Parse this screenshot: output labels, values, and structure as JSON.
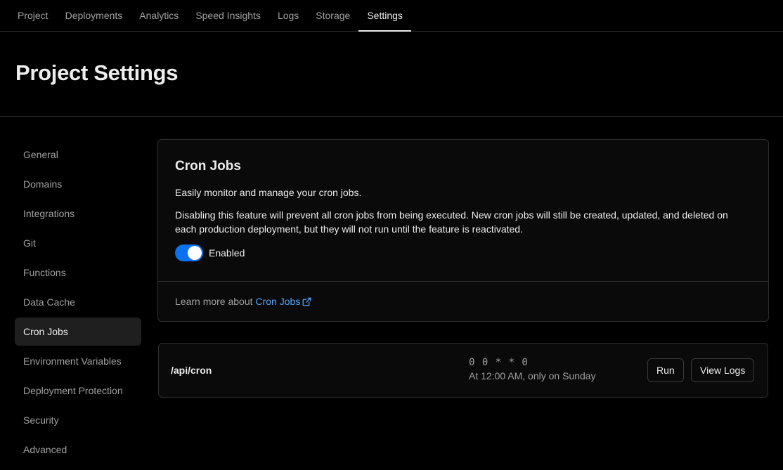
{
  "topnav": {
    "tabs": [
      {
        "label": "Project"
      },
      {
        "label": "Deployments"
      },
      {
        "label": "Analytics"
      },
      {
        "label": "Speed Insights"
      },
      {
        "label": "Logs"
      },
      {
        "label": "Storage"
      },
      {
        "label": "Settings",
        "active": true
      }
    ]
  },
  "header": {
    "title": "Project Settings"
  },
  "sidebar": {
    "items": [
      {
        "label": "General"
      },
      {
        "label": "Domains"
      },
      {
        "label": "Integrations"
      },
      {
        "label": "Git"
      },
      {
        "label": "Functions"
      },
      {
        "label": "Data Cache"
      },
      {
        "label": "Cron Jobs",
        "active": true
      },
      {
        "label": "Environment Variables"
      },
      {
        "label": "Deployment Protection"
      },
      {
        "label": "Security"
      },
      {
        "label": "Advanced"
      }
    ]
  },
  "cron_card": {
    "title": "Cron Jobs",
    "description": "Easily monitor and manage your cron jobs.",
    "note": "Disabling this feature will prevent all cron jobs from being executed. New cron jobs will still be created, updated, and deleted on each production deployment, but they will not run until the feature is reactivated.",
    "toggle_label": "Enabled",
    "toggle_on": true,
    "footer_text": "Learn more about",
    "footer_link": "Cron Jobs",
    "footer_link_icon": "external-link-icon"
  },
  "job": {
    "path": "/api/cron",
    "schedule": "0 0 * * 0",
    "schedule_human": "At 12:00 AM, only on Sunday",
    "run_label": "Run",
    "logs_label": "View Logs"
  },
  "colors": {
    "background": "#000000",
    "accent": "#0a72ef",
    "link": "#52a8ff"
  }
}
